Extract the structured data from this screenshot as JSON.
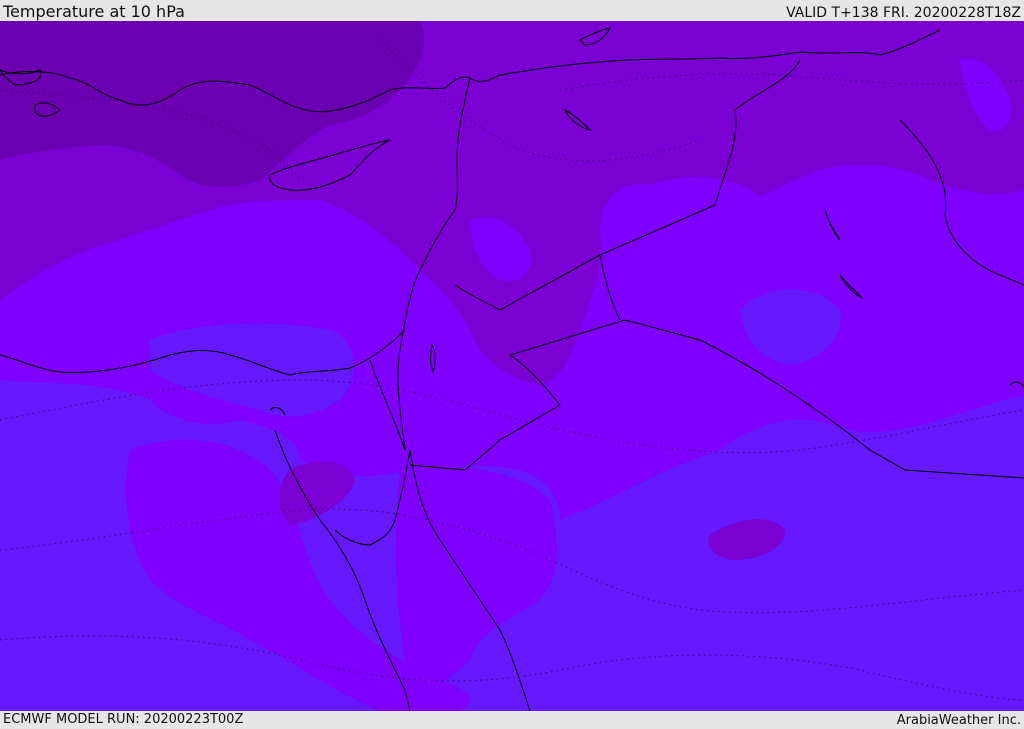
{
  "header": {
    "title": "Temperature at 10 hPa",
    "valid_time": "VALID T+138 FRI. 20200228T18Z"
  },
  "footer": {
    "model_run": "ECMWF MODEL RUN: 20200223T00Z",
    "credit": "ArabiaWeather Inc."
  },
  "map": {
    "variable": "Temperature",
    "level": "10 hPa",
    "fill_colors": {
      "coldest": "#6a00b2",
      "cold": "#7a00d4",
      "mid": "#8000ff",
      "warm": "#6618ff"
    },
    "boundary_color": "#000000",
    "contour_style": "dotted"
  }
}
